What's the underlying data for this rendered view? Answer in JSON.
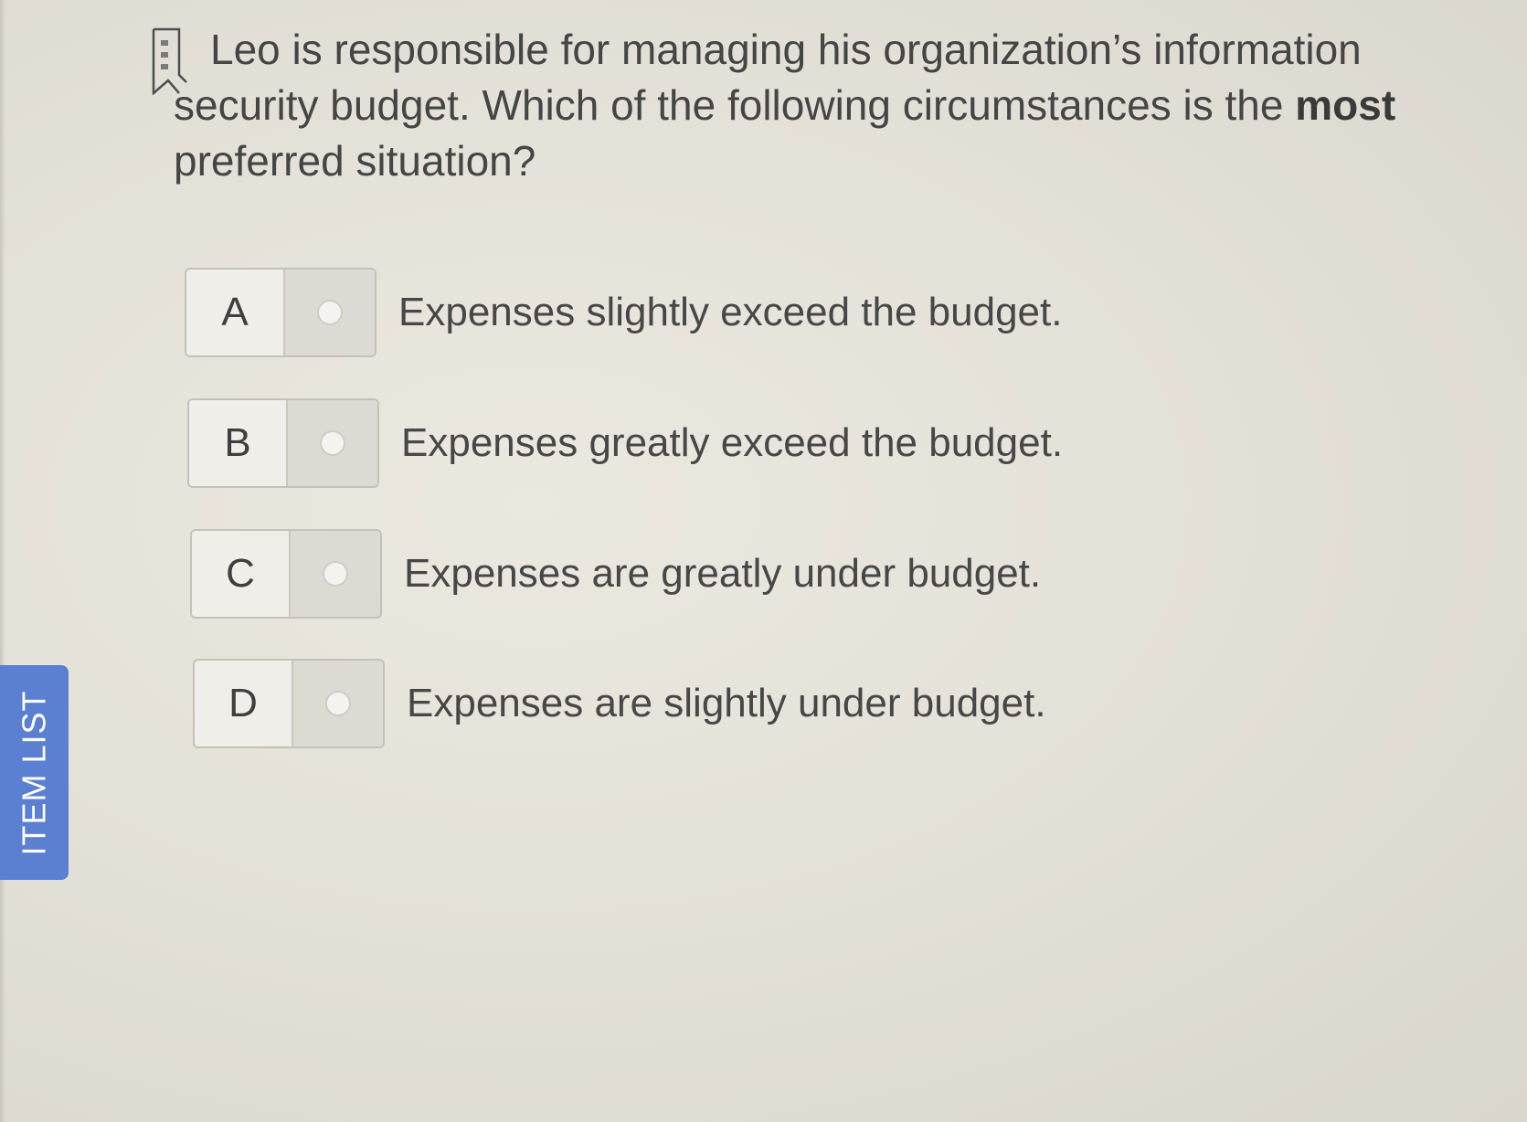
{
  "question": {
    "text_before_bold": "Leo is responsible for managing his organization’s information security budget. Which of the following circumstances is the ",
    "bold_word": "most",
    "text_after_bold": " preferred situation?"
  },
  "options": [
    {
      "letter": "A",
      "text": "Expenses slightly exceed the budget."
    },
    {
      "letter": "B",
      "text": "Expenses greatly exceed the budget."
    },
    {
      "letter": "C",
      "text": "Expenses are greatly under budget."
    },
    {
      "letter": "D",
      "text": "Expenses are slightly under budget."
    }
  ],
  "sidebar": {
    "item_list_label": "ITEM LIST"
  },
  "icons": {
    "bookmark": "bookmark-icon",
    "radio": "radio-unselected-icon"
  },
  "colors": {
    "item_list_tab": "#5b7fd1",
    "background": "#e4e1d8"
  }
}
